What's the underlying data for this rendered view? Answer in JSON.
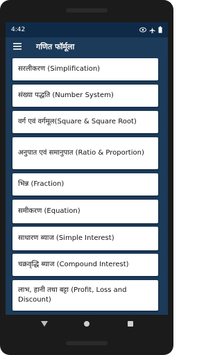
{
  "status_bar": {
    "time": "4:42",
    "icons": [
      "eye-icon",
      "airplane-icon",
      "battery-icon"
    ]
  },
  "app_bar": {
    "title": "गणित फॉर्मूला",
    "menu_icon": "hamburger-menu-icon"
  },
  "items": [
    {
      "label": "सरलीकरण (Simplification)"
    },
    {
      "label": "संख्या पद्धति (Number System)"
    },
    {
      "label": "वर्ग एवं वर्गमूल(Square & Square Root)"
    },
    {
      "label": "अनुपात एवं समानुपात (Ratio & Proportion)"
    },
    {
      "label": "भिन्न (Fraction)"
    },
    {
      "label": "समीकरण (Equation)"
    },
    {
      "label": "साधारण ब्याज (Simple Interest)"
    },
    {
      "label": "चक्रवृद्धि ब्याज (Compound Interest)"
    },
    {
      "label": "लाभ, हानी तथा बट्टा (Profit, Loss and Discount)"
    }
  ],
  "nav_bar": {
    "back": "back-icon",
    "home": "home-icon",
    "recents": "recents-icon"
  },
  "colors": {
    "app_bar": "#1c3a59",
    "status_bar": "#0f2a47",
    "card": "#ffffff"
  }
}
